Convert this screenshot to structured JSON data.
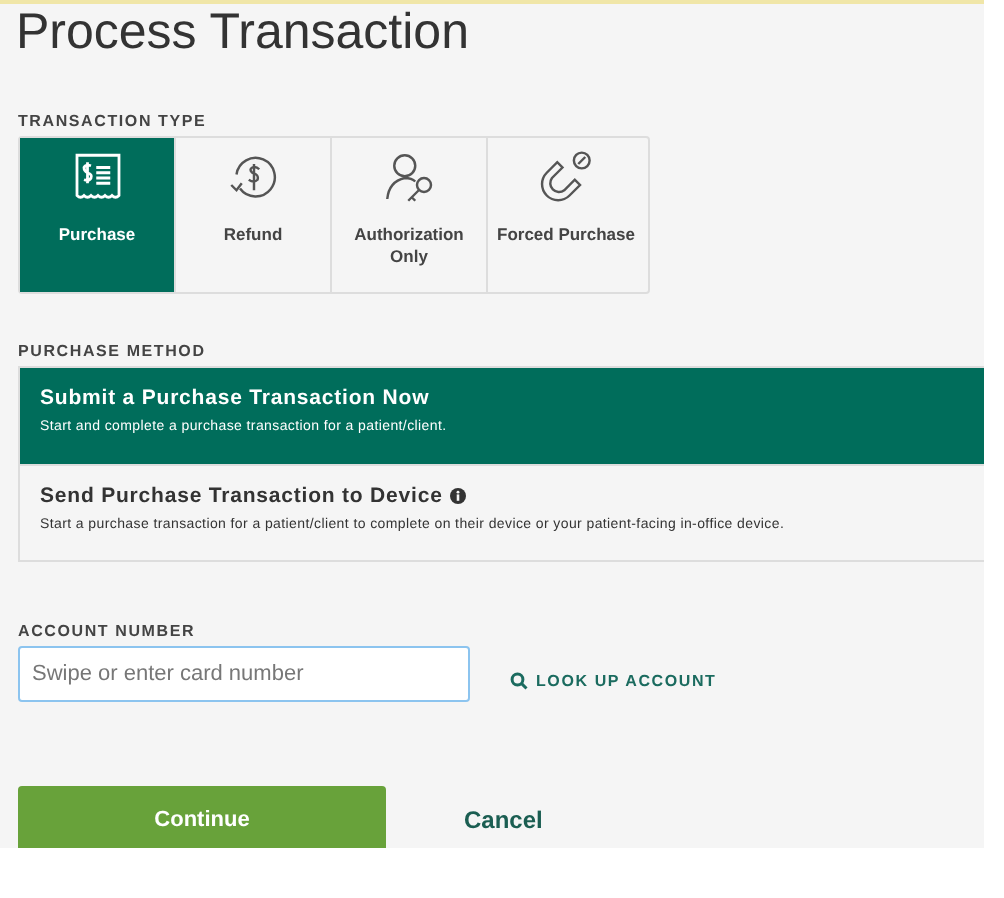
{
  "title": "Process Transaction",
  "transaction_type": {
    "label": "TRANSACTION TYPE",
    "options": [
      {
        "kind": "receipt",
        "label": "Purchase",
        "selected": true
      },
      {
        "kind": "refund",
        "label": "Refund",
        "selected": false
      },
      {
        "kind": "key",
        "label": "Authorization Only",
        "selected": false
      },
      {
        "kind": "magnet",
        "label": "Forced Purchase",
        "selected": false
      }
    ]
  },
  "purchase_method": {
    "label": "PURCHASE METHOD",
    "options": [
      {
        "title": "Submit a Purchase Transaction Now",
        "description": "Start and complete a purchase transaction for a patient/client.",
        "info": false,
        "selected": true
      },
      {
        "title": "Send Purchase Transaction to Device",
        "description": "Start a purchase transaction for a patient/client to complete on their device or your patient-facing in-office device.",
        "info": true,
        "selected": false
      }
    ]
  },
  "account_number": {
    "label": "ACCOUNT NUMBER",
    "placeholder": "Swipe or enter card number",
    "lookup": "LOOK UP ACCOUNT"
  },
  "buttons": {
    "primary": "Continue",
    "secondary": "Cancel"
  }
}
